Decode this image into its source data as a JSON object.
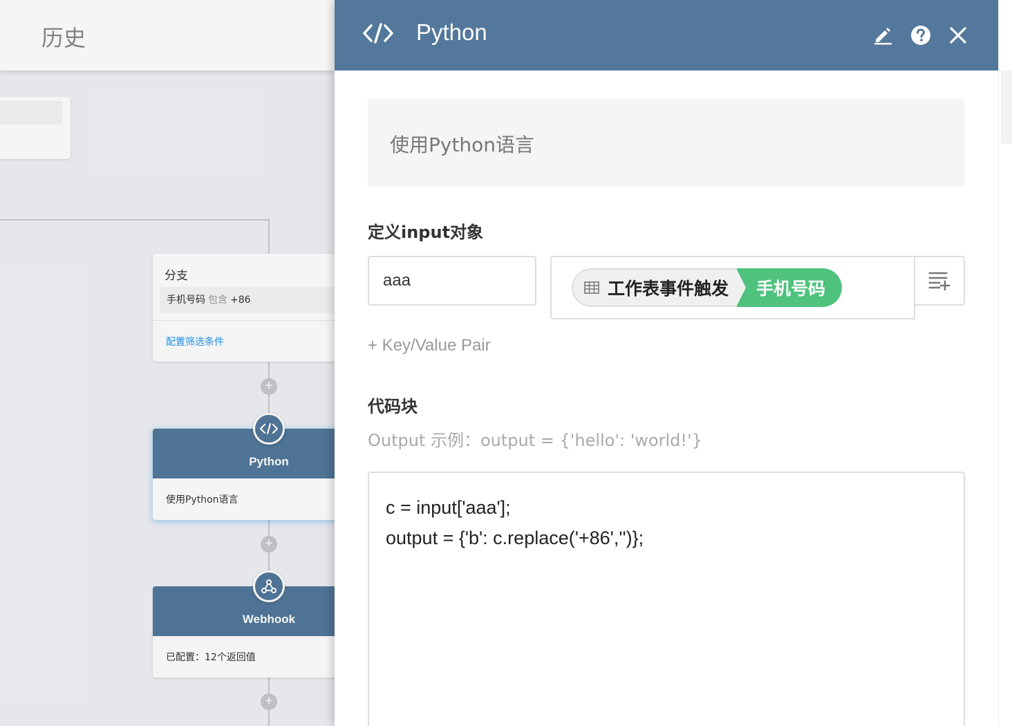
{
  "canvas": {
    "history_label": "历史",
    "branch_node": {
      "title": "分支",
      "condition": {
        "field": "手机号码",
        "operator": "包含",
        "value": "+86"
      },
      "config_link": "配置筛选条件"
    },
    "python_node": {
      "title": "Python",
      "description": "使用Python语言"
    },
    "webhook_node": {
      "title": "Webhook",
      "description": "已配置：12个返回值"
    }
  },
  "panel": {
    "title": "Python",
    "description": "使用Python语言",
    "input_section_label": "定义input对象",
    "input_pair": {
      "key": "aaa",
      "value_source": "工作表事件触发",
      "value_field": "手机号码"
    },
    "add_pair_label": "+ Key/Value Pair",
    "code_section_label": "代码块",
    "output_hint": "Output 示例：output = {'hello': 'world!'}",
    "code_lines": [
      "c = input['aaa'];",
      "output = {'b': c.replace('+86','')};"
    ]
  },
  "colors": {
    "header": "#53789b",
    "tag_green": "#4fc27e",
    "link_blue": "#2196f3"
  },
  "icons": [
    "code-icon",
    "edit-icon",
    "help-icon",
    "close-icon",
    "table-icon",
    "list-add-icon",
    "webhook-icon",
    "plus-icon"
  ]
}
